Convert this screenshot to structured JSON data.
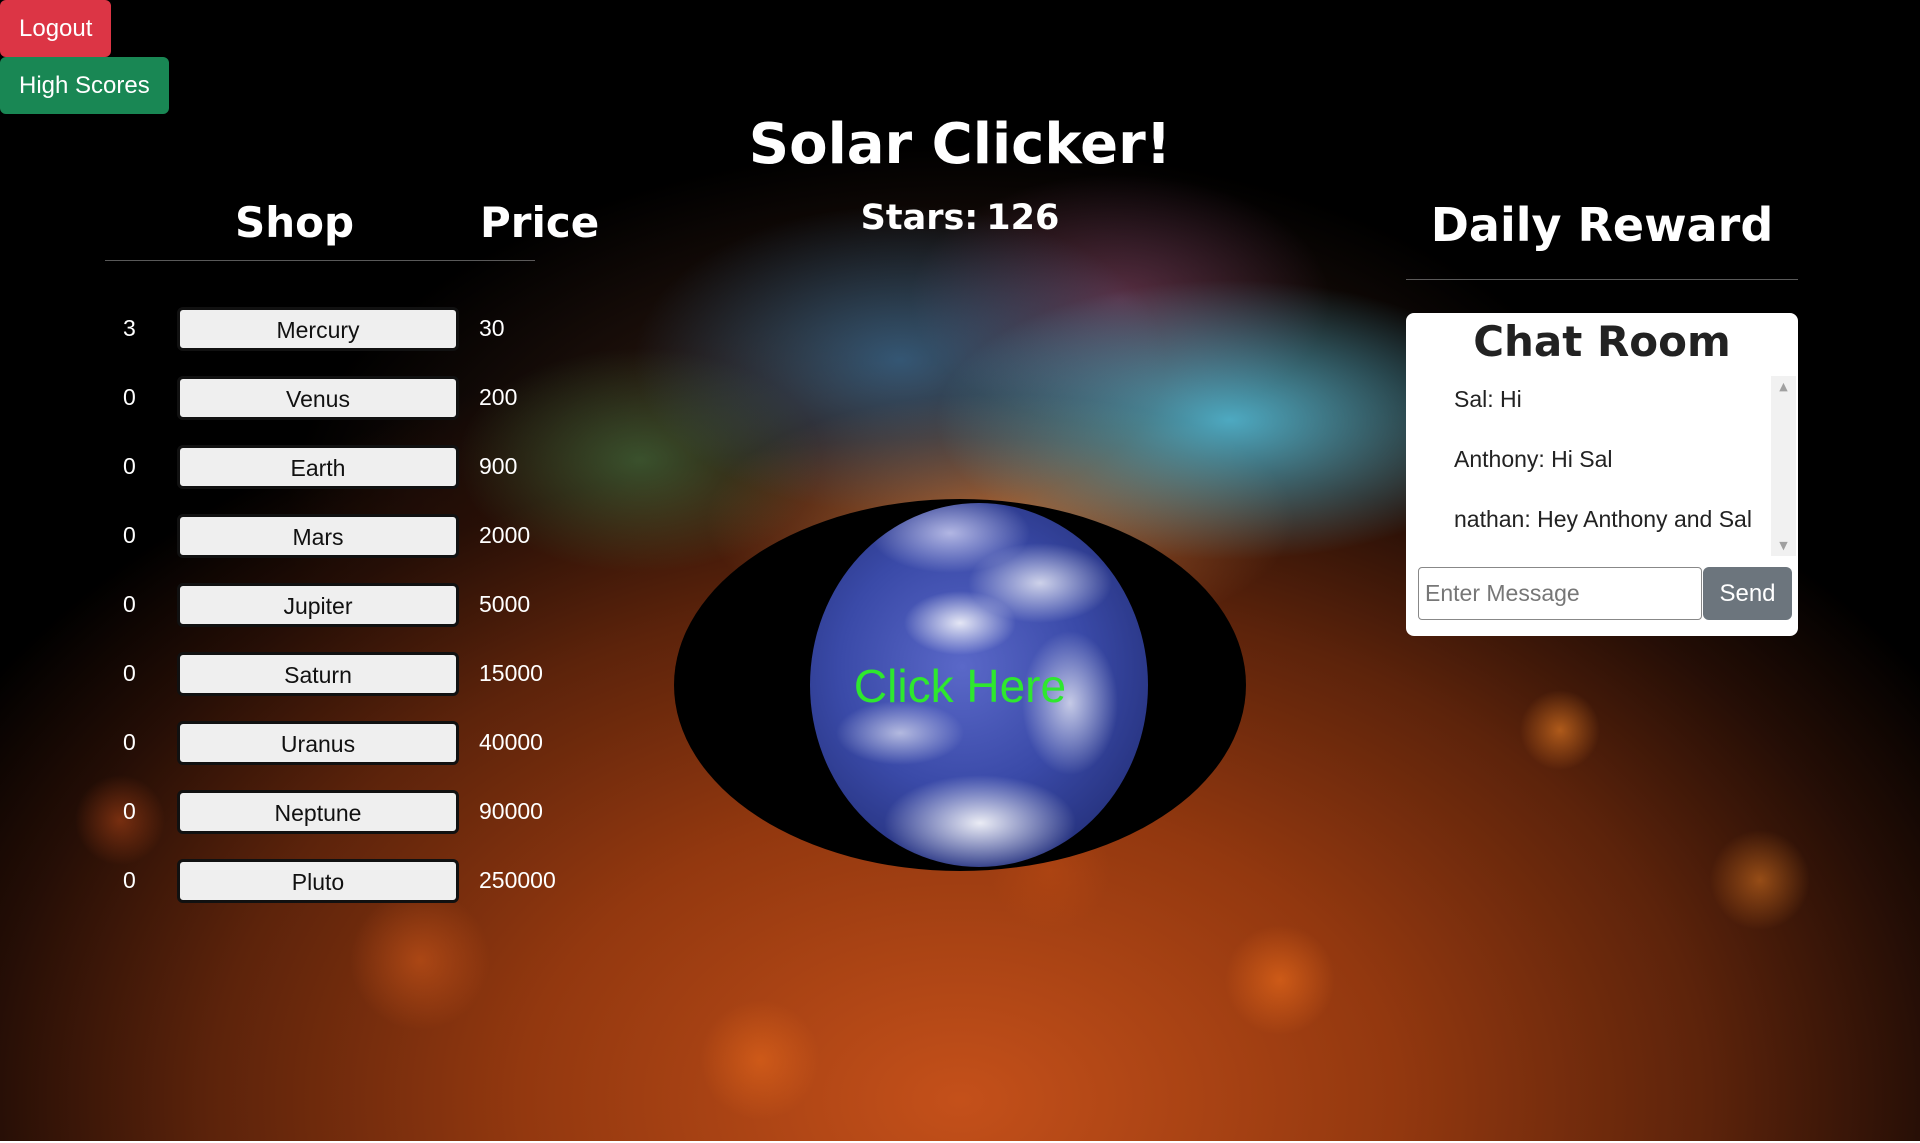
{
  "top_buttons": {
    "logout_label": "Logout",
    "high_scores_label": "High Scores"
  },
  "game": {
    "title": "Solar Clicker!",
    "stars_label": "Stars:",
    "stars_value": "126",
    "click_label": "Click Here"
  },
  "shop": {
    "header_shop": "Shop",
    "header_price": "Price",
    "items": [
      {
        "qty": "3",
        "name": "Mercury",
        "price": "30"
      },
      {
        "qty": "0",
        "name": "Venus",
        "price": "200"
      },
      {
        "qty": "0",
        "name": "Earth",
        "price": "900"
      },
      {
        "qty": "0",
        "name": "Mars",
        "price": "2000"
      },
      {
        "qty": "0",
        "name": "Jupiter",
        "price": "5000"
      },
      {
        "qty": "0",
        "name": "Saturn",
        "price": "15000"
      },
      {
        "qty": "0",
        "name": "Uranus",
        "price": "40000"
      },
      {
        "qty": "0",
        "name": "Neptune",
        "price": "90000"
      },
      {
        "qty": "0",
        "name": "Pluto",
        "price": "250000"
      }
    ]
  },
  "daily_reward": {
    "label": "Daily Reward"
  },
  "chat": {
    "title": "Chat Room",
    "messages": [
      "Sal: Hi",
      "Anthony: Hi Sal",
      "nathan: Hey Anthony and Sal"
    ],
    "input_placeholder": "Enter Message",
    "send_label": "Send"
  },
  "icons": {
    "scroll_up": "scroll-up-arrow-icon",
    "scroll_down": "scroll-down-arrow-icon"
  },
  "colors": {
    "logout": "#dc3545",
    "high_scores": "#198754",
    "click_text": "#2ee82e",
    "send": "#6c757d"
  }
}
